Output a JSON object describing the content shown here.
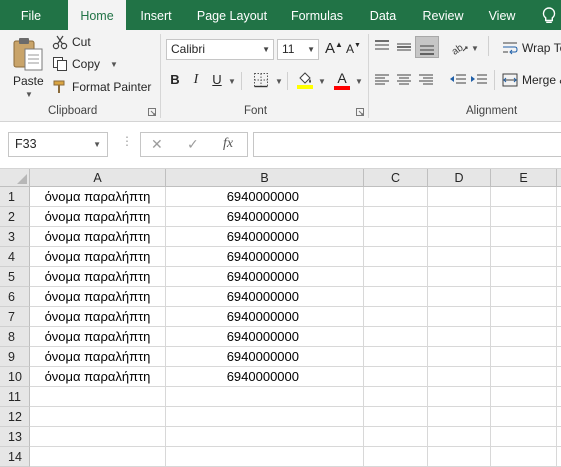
{
  "tabs": [
    "File",
    "Home",
    "Insert",
    "Page Layout",
    "Formulas",
    "Data",
    "Review",
    "View"
  ],
  "active_tab": "Home",
  "clipboard": {
    "paste": "Paste",
    "cut": "Cut",
    "copy": "Copy",
    "format_painter": "Format Painter",
    "group_label": "Clipboard"
  },
  "font": {
    "name": "Calibri",
    "size": "11",
    "bold": "B",
    "italic": "I",
    "underline": "U",
    "grow": "A",
    "shrink": "A",
    "font_color_glyph": "A",
    "group_label": "Font"
  },
  "alignment": {
    "wrap_text": "Wrap Te",
    "merge": "Merge &",
    "group_label": "Alignment"
  },
  "formula_bar": {
    "name_box": "F33",
    "cancel": "✕",
    "enter": "✓",
    "fx": "fx",
    "content": ""
  },
  "columns": [
    "A",
    "B",
    "C",
    "D",
    "E"
  ],
  "rows": [
    {
      "num": "1",
      "name": "όνομα παραλήπτη",
      "phone": "6940000000"
    },
    {
      "num": "2",
      "name": "όνομα παραλήπτη",
      "phone": "6940000000"
    },
    {
      "num": "3",
      "name": "όνομα παραλήπτη",
      "phone": "6940000000"
    },
    {
      "num": "4",
      "name": "όνομα παραλήπτη",
      "phone": "6940000000"
    },
    {
      "num": "5",
      "name": "όνομα παραλήπτη",
      "phone": "6940000000"
    },
    {
      "num": "6",
      "name": "όνομα παραλήπτη",
      "phone": "6940000000"
    },
    {
      "num": "7",
      "name": "όνομα παραλήπτη",
      "phone": "6940000000"
    },
    {
      "num": "8",
      "name": "όνομα παραλήπτη",
      "phone": "6940000000"
    },
    {
      "num": "9",
      "name": "όνομα παραλήπτη",
      "phone": "6940000000"
    },
    {
      "num": "10",
      "name": "όνομα παραλήπτη",
      "phone": "6940000000"
    },
    {
      "num": "11",
      "name": "",
      "phone": ""
    },
    {
      "num": "12",
      "name": "",
      "phone": ""
    },
    {
      "num": "13",
      "name": "",
      "phone": ""
    },
    {
      "num": "14",
      "name": "",
      "phone": ""
    }
  ],
  "colors": {
    "ribbon_green": "#217346",
    "highlight_yellow": "#ffff00",
    "font_red": "#ff0000"
  }
}
